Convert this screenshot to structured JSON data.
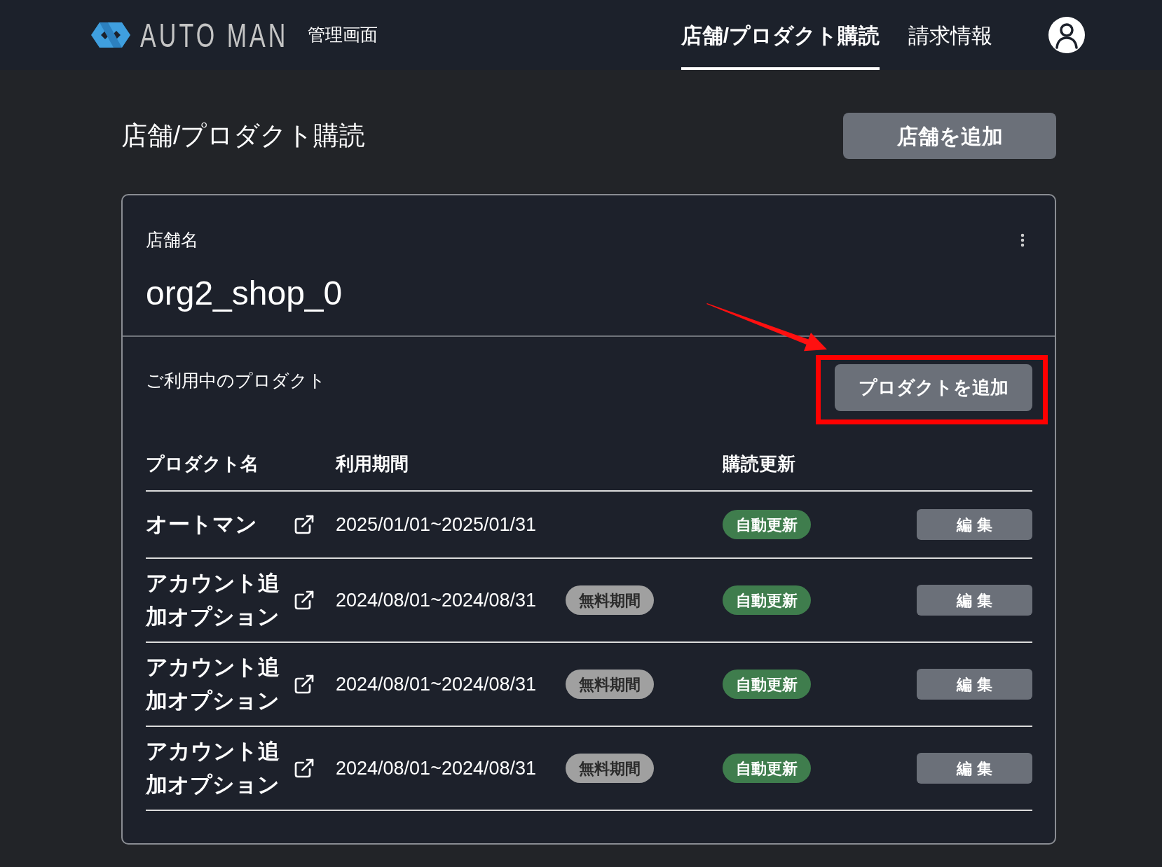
{
  "header": {
    "logo": {
      "text": "AUTO MAN"
    },
    "subtitle": "管理画面",
    "nav": [
      {
        "label": "店舗/プロダクト購読",
        "selected": true
      },
      {
        "label": "請求情報",
        "selected": false
      }
    ]
  },
  "page": {
    "title": "店舗/プロダクト購読",
    "add_shop_button": "店舗を追加"
  },
  "shop_card": {
    "name_label": "店舗名",
    "name": "org2_shop_0",
    "products_label": "ご利用中のプロダクト",
    "add_product_button": {
      "label": "プロダクトを追加",
      "highlighted": true
    },
    "table": {
      "columns": [
        "プロダクト名",
        "利用期間",
        "購読更新"
      ],
      "rows": [
        {
          "product": "オートマン",
          "period": "2025/01/01~2025/01/31",
          "renewal": "自動更新",
          "action": "編 集"
        },
        {
          "product": "アカウント追加オプション",
          "period": "2024/08/01~2024/08/31",
          "period_tag": "無料期間",
          "renewal": "自動更新",
          "action": "編 集"
        },
        {
          "product": "アカウント追加オプション",
          "period": "2024/08/01~2024/08/31",
          "period_tag": "無料期間",
          "renewal": "自動更新",
          "action": "編 集"
        },
        {
          "product": "アカウント追加オプション",
          "period": "2024/08/01~2024/08/31",
          "period_tag": "無料期間",
          "renewal": "自動更新",
          "action": "編 集"
        }
      ]
    }
  }
}
